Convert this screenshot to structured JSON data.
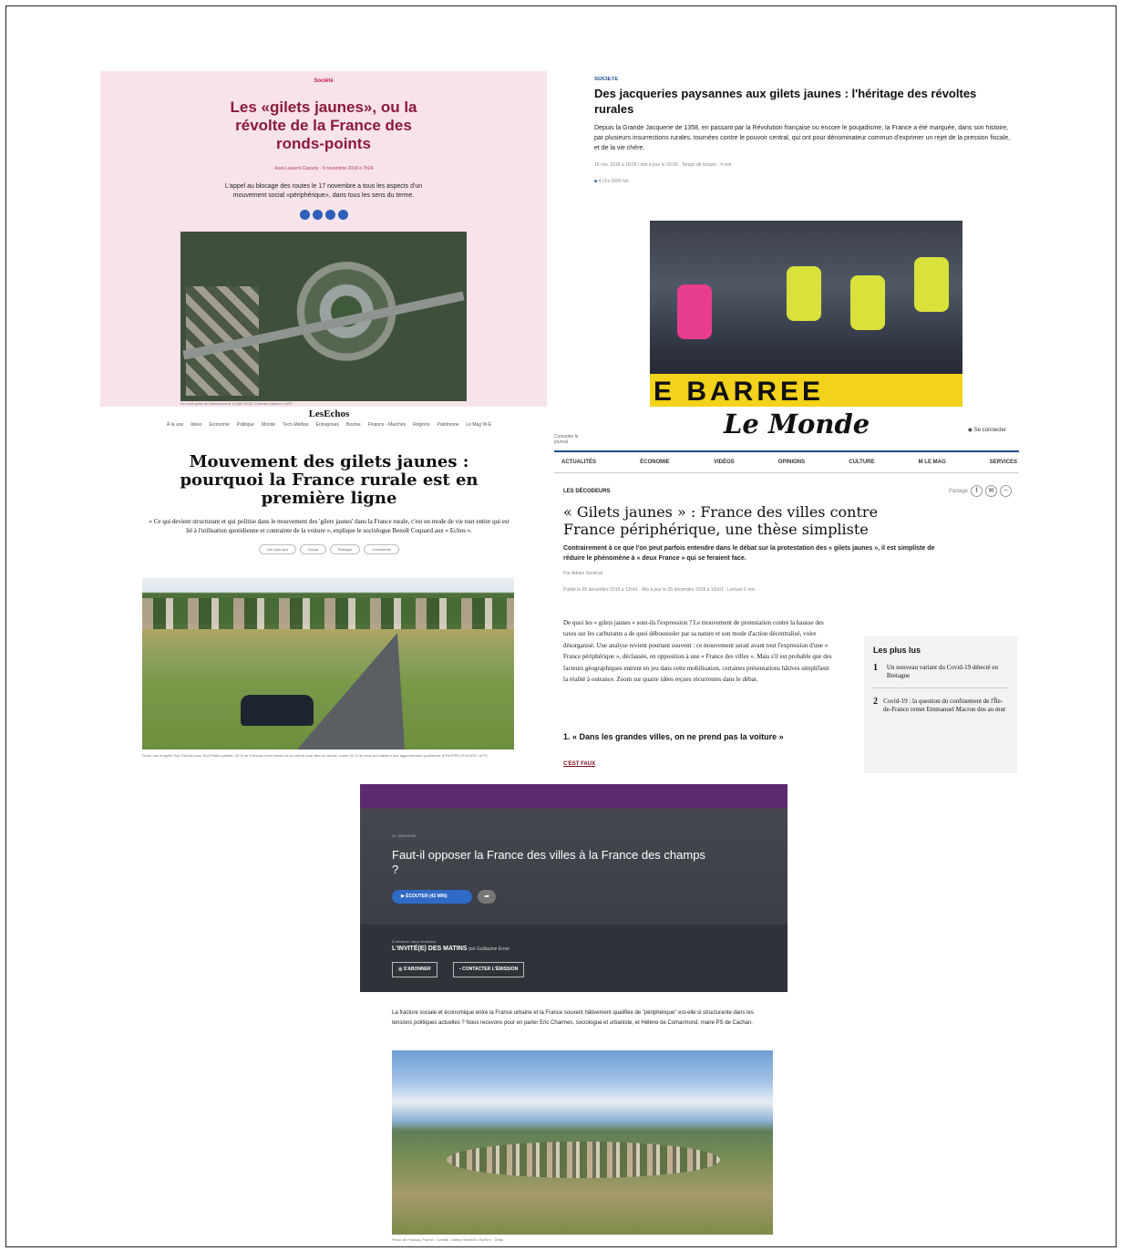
{
  "liberation": {
    "kicker": "Société",
    "title": "Les «gilets jaunes», ou la révolte de la France des ronds-points",
    "byline": "Jean-Laurent Cassely · 9 novembre 2018 à 7h24",
    "lede": "L'appel au blocage des routes le 17 novembre a tous les aspects d'un mouvement social «périphérique», dans tous les sens du terme.",
    "caption": "Un rond-point de lotissement le 14 juin 2013 | Thomas Samson / AFP"
  },
  "lemonde_jacqueries": {
    "kicker": "SOCIÉTÉ",
    "title": "Des jacqueries paysannes aux gilets jaunes : l'héritage des révoltes rurales",
    "lede": "Depuis la Grande Jacquerie de 1358, en passant par la Révolution française ou encore le poujadisme, la France a été marquée, dans son histoire, par plusieurs insurrections rurales, tournées contre le pouvoir central, qui ont pour dénominateur commun d'exprimer un rejet de la pression fiscale, et de la vie chère.",
    "meta": "16 nov. 2018 à 18:05 | mis à jour le 20:00 · Temps de lecture : 4 min",
    "meta2": "4  |  Ex 2000 h/s",
    "sign": "E BARREE"
  },
  "lesechos": {
    "logo": "LesEchos",
    "nav": [
      "À la une",
      "Idées",
      "Économie",
      "Politique",
      "Monde",
      "Tech-Médias",
      "Entreprises",
      "Bourse",
      "Finance - Marchés",
      "Régions",
      "Patrimoine",
      "Le Mag W-E"
    ],
    "title": "Mouvement des gilets jaunes : pourquoi la France rurale est en première ligne",
    "lede": "« Ce qui devient structurant et qui politise dans le mouvement des 'gilets jaunes' dans la France rurale, c'est un mode de vie tout entier qui est lié à l'utilisation quotidienne et contrainte de la voiture », explique le sociologue Benoît Coquard aux « Echos ».",
    "chips": [
      "Lire plus tard",
      "Social",
      "Partager",
      "Commenter"
    ],
    "caption": "Selon une enquête Ifop-Fiducial pour Sud Radio publiée, 30 % de Français n'ont besoin de la voiture pour aller au travail, contre 54 % de ceux qui habitent une agglomération parisienne (PHILIPPE HUGUEN / AFP)"
  },
  "lemonde_decodeurs": {
    "consult": "Consulter le journal",
    "logo": "Le Monde",
    "login": "Se connecter",
    "nav": [
      "ACTUALITÉS",
      "ÉCONOMIE",
      "VIDÉOS",
      "OPINIONS",
      "CULTURE",
      "M LE MAG",
      "SERVICES"
    ],
    "rubric": "LES DÉCODEURS",
    "share_label": "Partage",
    "title": "« Gilets jaunes » : France des villes contre France périphérique, une thèse simpliste",
    "lede": "Contrairement à ce que l'on peut parfois entendre dans le débat sur la protestation des « gilets jaunes », il est simpliste de réduire le phénomène à « deux France » qui se feraient face.",
    "author": "Par Adrien Sénécat",
    "pub": "Publié le 05 décembre 2018 à 12h41 · Mis à jour le 05 décembre 2018 à 15h01 · Lecture 6 min.",
    "body": "De quoi les « gilets jaunes » sont-ils l'expression ? Le mouvement de protestation contre la hausse des taxes sur les carburants a de quoi déboussoler par sa nature et son mode d'action décentralisé, voire désorganisé. Une analyse revient pourtant souvent : ce mouvement serait avant tout l'expression d'une « France périphérique », déclassée, en opposition à une « France des villes ». Mais s'il est probable que des facteurs géographiques entrent en jeu dans cette mobilisation, certaines présentations hâtives simplifient la réalité à outrance. Zoom sur quatre idées reçues récurrentes dans le débat.",
    "h2": "1. « Dans les grandes villes, on ne prend pas la voiture »",
    "faux": "C'EST FAUX",
    "popular_title": "Les plus lus",
    "popular": [
      {
        "num": "1",
        "text": "Un nouveau variant du Covid-19 détecté en Bretagne"
      },
      {
        "num": "2",
        "text": "Covid-19 : la question du confinement de l'Île-de-France remet Emmanuel Macron dos au mur"
      }
    ]
  },
  "franceculture": {
    "date": "LE 15/01/2020",
    "title": "Faut-il opposer la France des villes à la France des champs ?",
    "play": "▶  ÉCOUTER (42 MIN)",
    "share": "➦",
    "retrouver": "À retrouver dans l'émission",
    "show": "L'INVITÉ(E) DES MATINS",
    "show_by": "par Guillaume Erner",
    "subscribe": "S'ABONNER",
    "contact": "CONTACTER L'ÉMISSION",
    "intro": "La fracture sociale et économique entre la France urbaine et la France souvent hâtivement qualifiée de \"périphérique\" est-elle si structurante dans les tensions politiques actuelles ? Nous recevons pour en parler Eric Charmes, sociologue et urbaniste, et Hélène de Comarmond, maire PS de Cachan.",
    "caption": "Photo de Frossay, France · Crédits : Valery Hache/A / EyeEm · Getty"
  }
}
